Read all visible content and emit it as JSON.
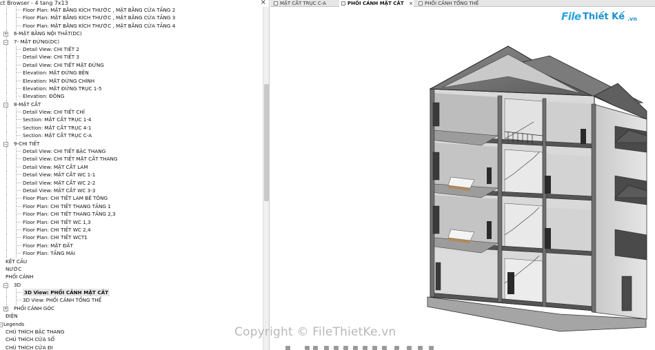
{
  "window": {
    "title": "ct Browser - 4 tang 7x13",
    "close_glyph": "×"
  },
  "tabs": [
    {
      "label": "MẶT CẮT TRỤC C-A",
      "close": ""
    },
    {
      "label": "PHỐI CẢNH MẶT CẮT",
      "close": "×"
    },
    {
      "label": "PHỐI CẢNH TỔNG THỂ",
      "close": ""
    }
  ],
  "tree": [
    {
      "label": "Floor Plan: MẶT BẰNG KÍCH THƯỚC , MẶT BẰNG CỬA TẦNG 2",
      "level": 2
    },
    {
      "label": "Floor Plan: MẶT BẰNG KÍCH THƯỚC , MẶT BẰNG CỬA TẦNG 3",
      "level": 2
    },
    {
      "label": "Floor Plan: MẶT BẰNG KÍCH THƯỚC , MẶT BẰNG CỬA TẦNG 4",
      "level": 2
    },
    {
      "label": "6-MẶT BẰNG NỘI THẤT(DC)",
      "level": 1,
      "toggle": "+"
    },
    {
      "label": "7- MẶT ĐỨNG(DC)",
      "level": 1,
      "toggle": "−"
    },
    {
      "label": "Detail View: CHI TIẾT 2",
      "level": 2
    },
    {
      "label": "Detail View: CHI TIẾT 3",
      "level": 2
    },
    {
      "label": "Detail View: CHI TIẾT MẶT ĐỨNG",
      "level": 2
    },
    {
      "label": "Elevation: MẶT ĐỨNG BÊN",
      "level": 2
    },
    {
      "label": "Elevation: MẶT ĐỨNG CHÍNH",
      "level": 2
    },
    {
      "label": "Elevation: MẶT ĐỨNG TRỤC 1-5",
      "level": 2
    },
    {
      "label": "Elevation: ĐÔNG",
      "level": 2
    },
    {
      "label": "8-MẶT CẮT",
      "level": 1,
      "toggle": "−"
    },
    {
      "label": "Detail View: CHI TIẾT CHỈ",
      "level": 2
    },
    {
      "label": "Section: MẶT CẮT TRỤC 1-4",
      "level": 2
    },
    {
      "label": "Section: MẶT CẮT TRỤC 4-1",
      "level": 2
    },
    {
      "label": "Section: MẶT CẮT TRỤC C-A",
      "level": 2
    },
    {
      "label": "9-CHI TIẾT",
      "level": 1,
      "toggle": "−"
    },
    {
      "label": "Detail View: CHI TIẾT BẬC THANG",
      "level": 2
    },
    {
      "label": "Detail View: CHI TIẾT MẶT CẮT THANG",
      "level": 2
    },
    {
      "label": "Detail View: MẶT CẮT LAM",
      "level": 2
    },
    {
      "label": "Detail View: MẶT CẮT WC 1-1",
      "level": 2
    },
    {
      "label": "Detail View: MẶT CẮT WC 2-2",
      "level": 2
    },
    {
      "label": "Detail View: MẶT CẮT WC 3-3",
      "level": 2
    },
    {
      "label": "Floor Plan: CHI TIẾT LAM BÊ TÔNG",
      "level": 2
    },
    {
      "label": "Floor Plan: CHI TIẾT THANG TẦNG 1",
      "level": 2
    },
    {
      "label": "Floor Plan: CHI TIẾT THANG TẦNG 2,3",
      "level": 2
    },
    {
      "label": "Floor Plan: CHI TIẾT WC 1,3",
      "level": 2
    },
    {
      "label": "Floor Plan: CHI TIẾT WC 2,4",
      "level": 2
    },
    {
      "label": "Floor Plan: CHI TIẾT WCT1",
      "level": 2
    },
    {
      "label": "Floor Plan: MẶT ĐẤT",
      "level": 2
    },
    {
      "label": "Floor Plan: TẦNG MÁI",
      "level": 2
    },
    {
      "label": "KẾT CẤU",
      "level": 0
    },
    {
      "label": "NƯỚC",
      "level": 0
    },
    {
      "label": "PHỐI CẢNH",
      "level": 0
    },
    {
      "label": "3D",
      "level": 1,
      "toggle": "−"
    },
    {
      "label": "3D View: PHỐI CẢNH MẶT CẮT",
      "level": 2,
      "selected": true
    },
    {
      "label": "3D View: PHỐI CẢNH TỔNG THỂ",
      "level": 2
    },
    {
      "label": "PHỐI CẢNH GÓC",
      "level": 1,
      "toggle": "+"
    },
    {
      "label": "ĐIỆN",
      "level": 0
    },
    {
      "label": "Legends",
      "level": -1,
      "toggle": "−"
    },
    {
      "label": "CHÚ THÍCH BẬC THANG",
      "level": 0
    },
    {
      "label": "CHÚ THÍCH CỬA SỔ",
      "level": 0
    },
    {
      "label": "CHÚ THÍCH CỬA ĐI",
      "level": 0
    }
  ],
  "logo": {
    "file": "File",
    "rest": "Thiết Kế",
    "vn": ".vn"
  },
  "watermark": "Copyright © FileThietKe.vn",
  "colors": {
    "accent": "#29a6df",
    "selected_bg": "#e8e8e8",
    "tab_bar": "#e6e6e6"
  }
}
